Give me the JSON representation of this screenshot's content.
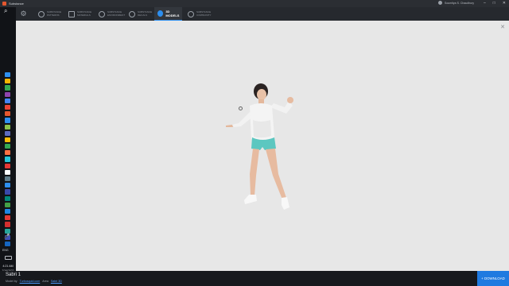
{
  "window": {
    "app_title": "Substance",
    "user_name": "Soumitya S. Chaudhury",
    "controls": [
      "–",
      "□",
      "✕"
    ]
  },
  "taskbar": {
    "language": "ENG",
    "time": "4:21 AM",
    "date": "7/16/2022",
    "app_colors": [
      "#2d8ff0",
      "#f4b400",
      "#34a853",
      "#8e44ad",
      "#4285f4",
      "#ea4335",
      "#e4572e",
      "#2d8ff0",
      "#8bc34a",
      "#5c6bc0",
      "#fbbc05",
      "#34a853",
      "#ff7043",
      "#26c6da",
      "#e53935",
      "#ffffff",
      "#607d8b",
      "#2d8ff0",
      "#3949ab",
      "#00897b",
      "#43a047",
      "#1e88e5",
      "#e53935",
      "#d32f2f",
      "#26a69a",
      "#3f51b5",
      "#1565c0"
    ]
  },
  "nav": {
    "tabs": [
      {
        "top": "SUBSTANCE",
        "bottom": "PATTERNS"
      },
      {
        "top": "SUBSTANCE",
        "bottom": "MATERIALS"
      },
      {
        "top": "SUBSTANCE",
        "bottom": "ENVIRONMENT"
      },
      {
        "top": "SUBSTANCE",
        "bottom": "DECALS"
      },
      {
        "model": "3D MODELS"
      },
      {
        "top": "SUBSTANCE",
        "bottom": "COMMUNITY"
      }
    ]
  },
  "footer": {
    "model_name": "Sabri 1",
    "credit_label": "Model by",
    "credit_link": "Turbosquid.com",
    "asset_label": "Area",
    "asset_link": "Sabri 3D",
    "download_label": "+ DOWNLOAD"
  }
}
